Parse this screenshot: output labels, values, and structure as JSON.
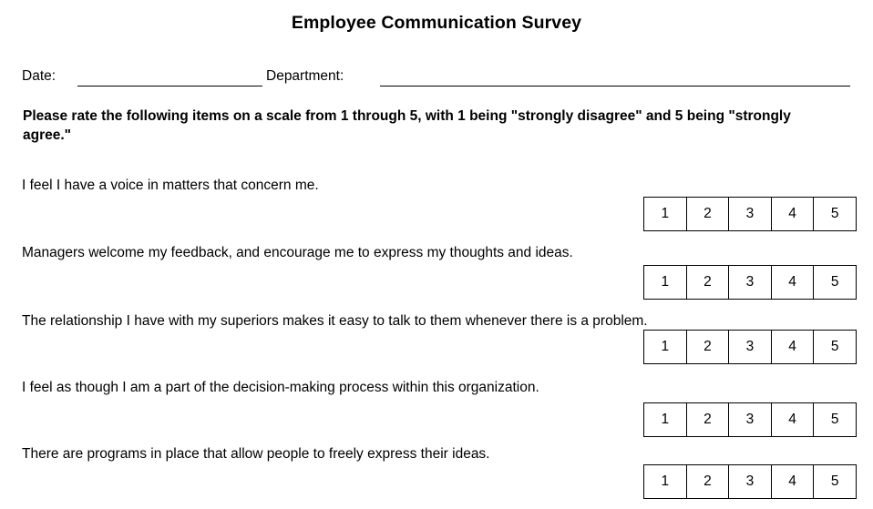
{
  "document": {
    "title": "Employee Communication Survey"
  },
  "meta": {
    "date_label": "Date:",
    "department_label": "Department:",
    "date_value": "",
    "department_value": ""
  },
  "instructions": {
    "text": "Please rate the following items on a scale from 1 through 5, with 1 being \"strongly disagree\" and 5 being \"strongly agree.\""
  },
  "scale": {
    "options": [
      "1",
      "2",
      "3",
      "4",
      "5"
    ],
    "min_label": "strongly disagree",
    "max_label": "strongly agree",
    "min_value": "1",
    "max_value": "5"
  },
  "questions": [
    {
      "text": "I feel I have a voice in matters that concern me."
    },
    {
      "text": "Managers welcome my feedback, and encourage me to express my thoughts and ideas."
    },
    {
      "text": "The relationship I have with my superiors makes it easy to talk to them whenever there is a problem."
    },
    {
      "text": "I feel as though I am a part of the decision-making process within this organization."
    },
    {
      "text": "There are programs in place that allow people to freely express their ideas."
    }
  ]
}
